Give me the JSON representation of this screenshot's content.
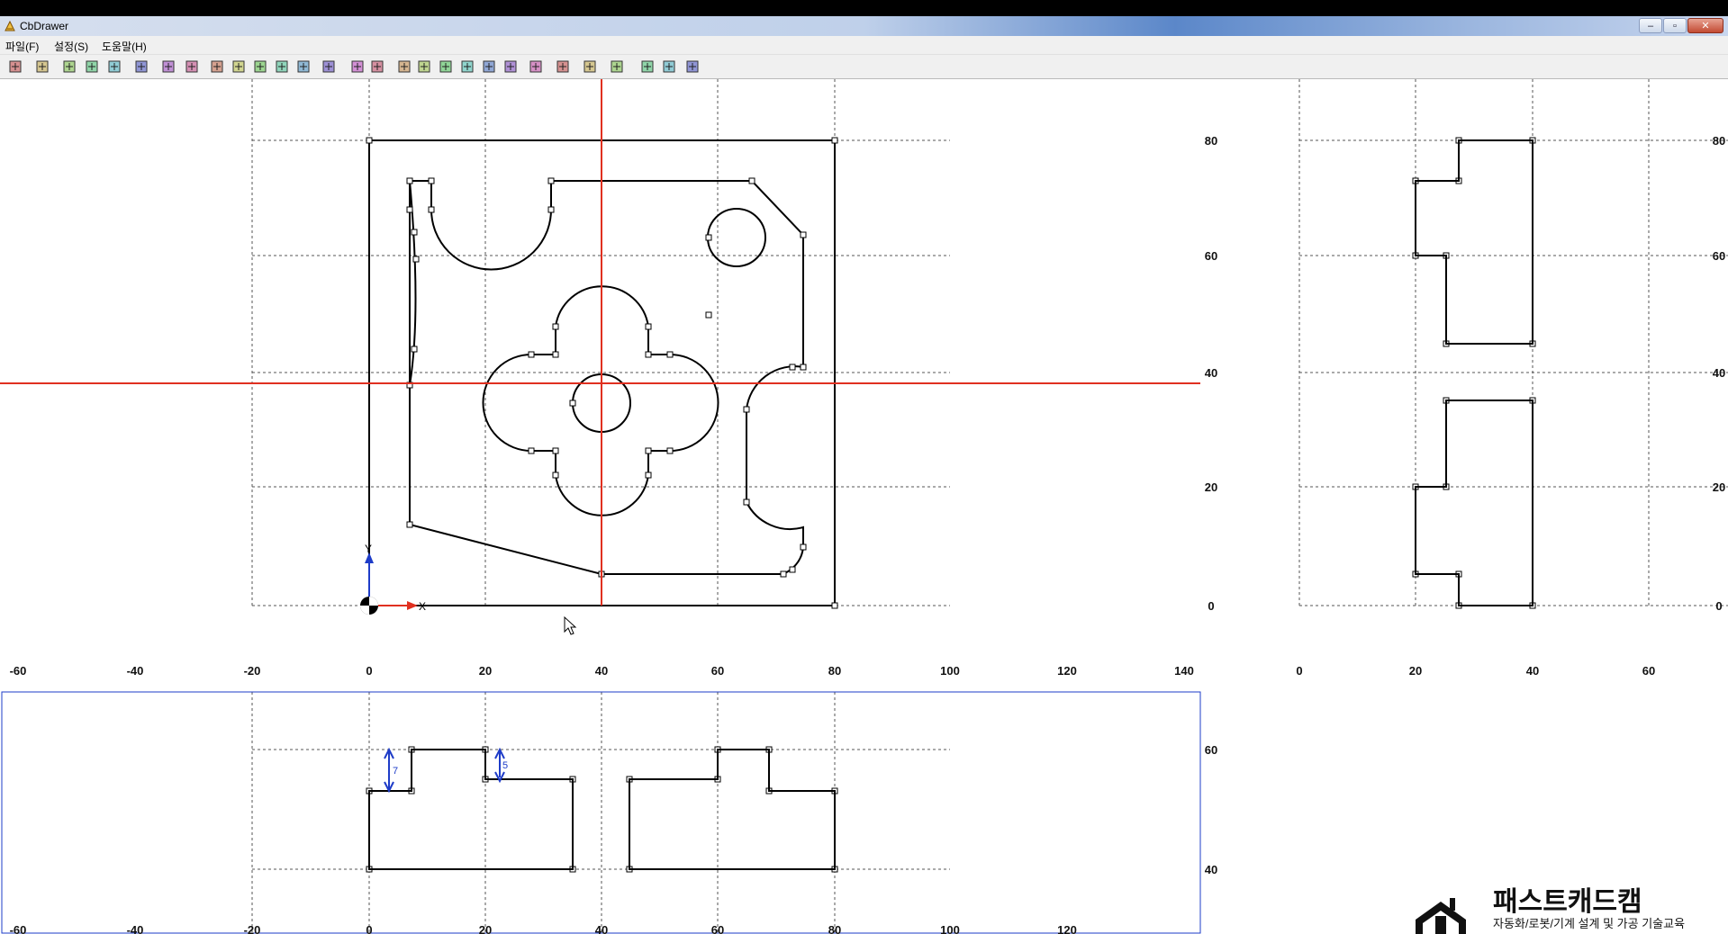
{
  "window": {
    "title": "CbDrawer",
    "minimize_icon": "minimize-icon",
    "maximize_icon": "maximize-icon",
    "close_icon": "close-icon"
  },
  "menu": [
    {
      "label": "파일(F)"
    },
    {
      "label": "설정(S)"
    },
    {
      "label": "도움말(H)"
    }
  ],
  "toolbar": [
    {
      "icon": "new-file-icon"
    },
    {
      "icon": "open-folder-icon"
    },
    {
      "icon": "view-a-icon"
    },
    {
      "icon": "view-b-icon"
    },
    {
      "icon": "solid-icon"
    },
    {
      "icon": "toggle-icon"
    },
    {
      "icon": "frame-a-icon"
    },
    {
      "icon": "frame-b-icon"
    },
    {
      "icon": "zoom-in-icon"
    },
    {
      "icon": "zoom-out-icon"
    },
    {
      "icon": "zoom-window-icon"
    },
    {
      "icon": "zoom-all-icon"
    },
    {
      "icon": "pan-icon"
    },
    {
      "icon": "render-icon"
    },
    {
      "icon": "select-icon"
    },
    {
      "icon": "select-add-icon"
    },
    {
      "icon": "dim-vertical-icon"
    },
    {
      "icon": "dim-horizontal-icon"
    },
    {
      "icon": "dim-aligned-icon"
    },
    {
      "icon": "dim-base-icon"
    },
    {
      "icon": "dim-radius-icon"
    },
    {
      "icon": "dim-diameter-icon"
    },
    {
      "icon": "trim-icon"
    },
    {
      "icon": "angle-icon"
    },
    {
      "icon": "export-icon"
    },
    {
      "icon": "help-icon"
    },
    {
      "icon": "print-icon"
    },
    {
      "icon": "print-setup-icon"
    },
    {
      "icon": "preview-icon"
    }
  ],
  "views": {
    "front": {
      "x_ticks": [
        "-60",
        "-40",
        "-20",
        "0",
        "20",
        "40",
        "60",
        "80",
        "100",
        "120",
        "140"
      ],
      "y_ticks": [
        "80",
        "60",
        "40",
        "20",
        "0"
      ],
      "axis_labels": {
        "x": "X",
        "y": "Y"
      }
    },
    "side": {
      "x_ticks": [
        "0",
        "20",
        "40",
        "60"
      ],
      "y_ticks": [
        "80",
        "60",
        "40",
        "20",
        "0"
      ]
    },
    "top": {
      "x_ticks": [
        "-60",
        "-40",
        "-20",
        "0",
        "20",
        "40",
        "60",
        "80",
        "100",
        "120"
      ],
      "y_ticks": [
        "60",
        "40"
      ],
      "dimensions": [
        "7",
        "5"
      ]
    }
  },
  "logo": {
    "brand": "패스트캐드캠",
    "tagline": "자동화/로봇/기계 설계 및 가공 기술교육"
  },
  "colors": {
    "crosshair": "#e03020",
    "dimension": "#1e3cc8",
    "grid": "#555555",
    "titlebar_accent": "#5b87c9"
  }
}
